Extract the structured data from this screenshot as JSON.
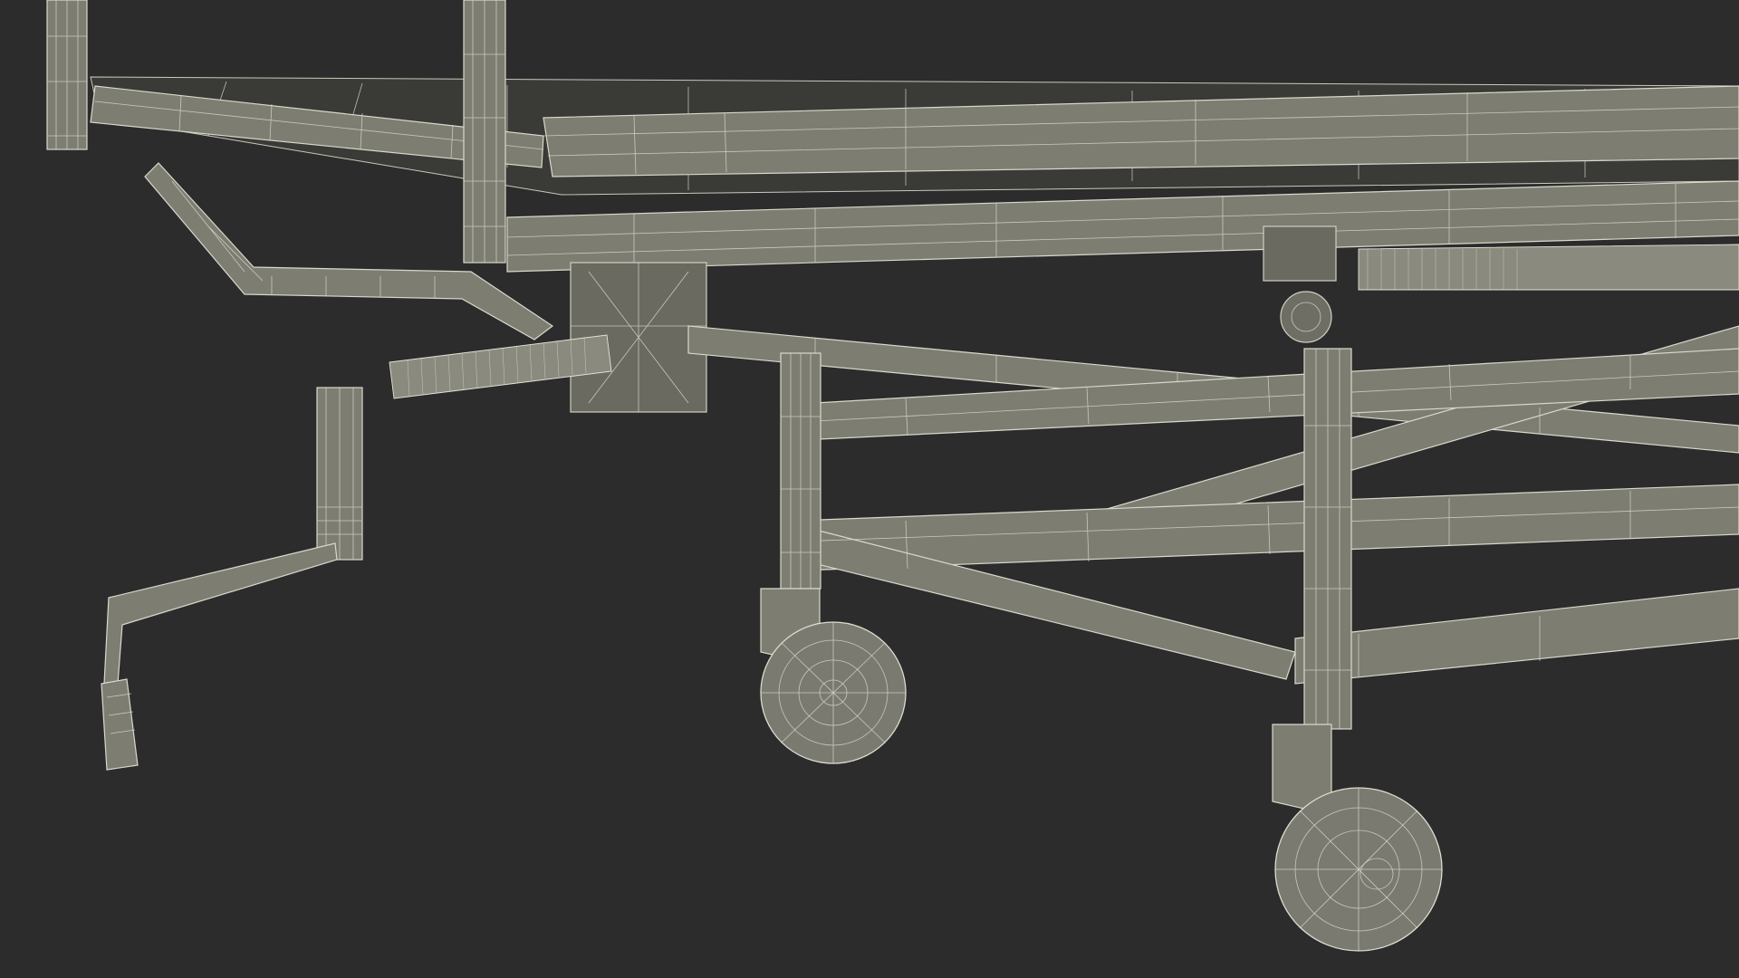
{
  "scene": {
    "subject": "stretcher-wireframe-render",
    "colors": {
      "background": "#2c2c2c",
      "model": "#7d7d72",
      "wireframe": "#d8d8cc"
    }
  }
}
